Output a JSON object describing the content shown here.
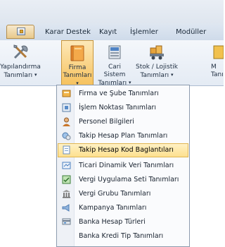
{
  "tabs": [
    {
      "label": "Karar Destek"
    },
    {
      "label": "Kayıt"
    },
    {
      "label": "İşlemler"
    },
    {
      "label": "Modüller"
    }
  ],
  "ribbon": {
    "buttons": [
      {
        "line1": "Yapılandırma",
        "line2": "Tanımları",
        "icon": "tools-icon"
      },
      {
        "line1": "Firma",
        "line2": "Tanımları",
        "icon": "folder-icon"
      },
      {
        "line1": "Cari Sistem",
        "line2": "Tanımları",
        "icon": "server-icon"
      },
      {
        "line1": "Stok / Lojistik",
        "line2": "Tanımları",
        "icon": "truck-icon"
      },
      {
        "line1": "M",
        "line2": "Tanı",
        "icon": "grid-icon"
      }
    ],
    "dropdown_glyph": "▾"
  },
  "menu": {
    "items": [
      {
        "label": "Firma ve Şube Tanımları",
        "icon": "branch-icon",
        "color": "#e9a23a"
      },
      {
        "label": "İşlem Noktası Tanımları",
        "icon": "point-icon",
        "color": "#5a8cc8"
      },
      {
        "label": "Personel Bilgileri",
        "icon": "person-icon",
        "color": "#c9772b"
      },
      {
        "label": "Takip Hesap Plan Tanımları",
        "icon": "account-plan-icon",
        "color": "#6a9ed4"
      },
      {
        "label": "Takip Hesap Kod Baglantıları",
        "icon": "account-link-icon",
        "color": "#7ea6d1"
      },
      {
        "label": "Ticari Dinamik Veri Tanımları",
        "icon": "data-icon",
        "color": "#4a7fc0"
      },
      {
        "label": "Vergi Uygulama Seti Tanımları",
        "icon": "tax-set-icon",
        "color": "#4c9c4a"
      },
      {
        "label": "Vergi Grubu Tanımları",
        "icon": "tax-group-icon",
        "color": "#7a7a7a"
      },
      {
        "label": "Kampanya Tanımları",
        "icon": "campaign-icon",
        "color": "#4f7db3"
      },
      {
        "label": "Banka Hesap Türleri",
        "icon": "bank-icon",
        "color": "#6f7e8f"
      },
      {
        "label": "Banka Kredi Tip Tanımları",
        "icon": "",
        "color": ""
      }
    ],
    "highlighted_index": 4
  }
}
